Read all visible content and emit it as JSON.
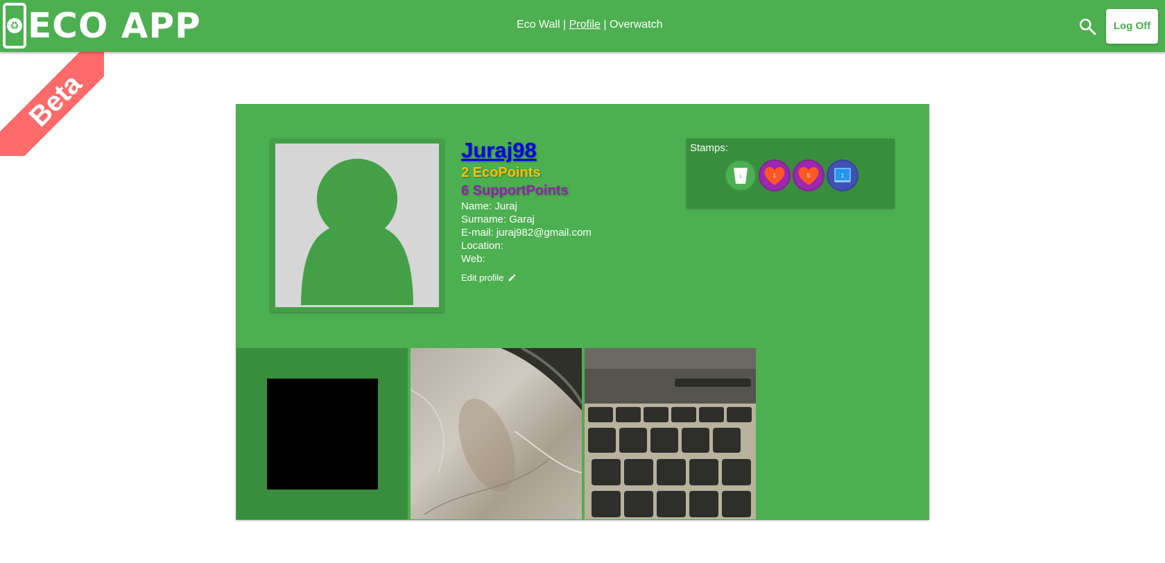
{
  "app": {
    "name": "ECO APP",
    "badge": "Beta"
  },
  "nav": {
    "eco_wall": "Eco Wall",
    "separator": "|",
    "profile": "Profile",
    "overwatch": "Overwatch"
  },
  "header": {
    "logoff_label": "Log Off",
    "search_icon": "search-icon"
  },
  "profile": {
    "username": "Juraj98",
    "ecopoints": "2 EcoPoints",
    "supportpoints": "6 SupportPoints",
    "name": "Name: Juraj",
    "surname": "Surname: Garaj",
    "email": "E-mail: juraj982@gmail.com",
    "location": "Location:",
    "web": "Web:",
    "edit_label": "Edit profile"
  },
  "stamps": {
    "title": "Stamps:",
    "items": [
      {
        "icon": "cup-icon",
        "count": "1",
        "color": "#4caf50"
      },
      {
        "icon": "heart-icon",
        "count": "1",
        "color": "#9c27b0"
      },
      {
        "icon": "heart-icon",
        "count": "5",
        "color": "#9c27b0"
      },
      {
        "icon": "monitor-icon",
        "count": "1",
        "color": "#3f51b5"
      }
    ]
  },
  "colors": {
    "primary": "#4caf50",
    "dark": "#388e3c",
    "ecopoints": "#ffc107",
    "supportpoints": "#8e24aa",
    "ribbon": "#ff6b6b"
  }
}
